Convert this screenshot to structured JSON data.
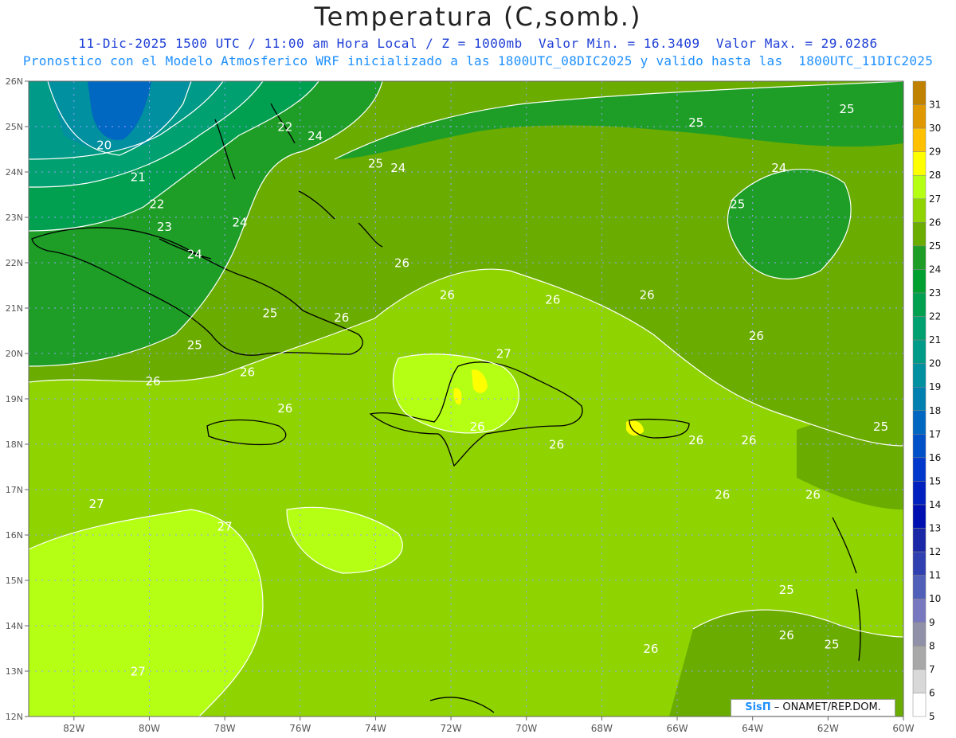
{
  "header": {
    "title": "Temperatura (C,somb.)",
    "subtitle_line1": "11-Dic-2025 1500 UTC / 11:00 am Hora Local / Z = 1000mb  Valor Min. = 16.3409  Valor Max. = 29.0286",
    "subtitle_line2": "Pronostico con el Modelo Atmosferico WRF inicializado a las 1800UTC_08DIC2025 y valido hasta las  1800UTC_11DIC2025"
  },
  "map": {
    "lon_range": [
      -83.2,
      -60
    ],
    "lat_range": [
      12,
      26
    ],
    "lon_ticks": [
      {
        "value": -82,
        "label": "82W"
      },
      {
        "value": -80,
        "label": "80W"
      },
      {
        "value": -78,
        "label": "78W"
      },
      {
        "value": -76,
        "label": "76W"
      },
      {
        "value": -74,
        "label": "74W"
      },
      {
        "value": -72,
        "label": "72W"
      },
      {
        "value": -70,
        "label": "70W"
      },
      {
        "value": -68,
        "label": "68W"
      },
      {
        "value": -66,
        "label": "66W"
      },
      {
        "value": -64,
        "label": "64W"
      },
      {
        "value": -62,
        "label": "62W"
      },
      {
        "value": -60,
        "label": "60W"
      }
    ],
    "lat_ticks": [
      {
        "value": 26,
        "label": "26N"
      },
      {
        "value": 25,
        "label": "25N"
      },
      {
        "value": 24,
        "label": "24N"
      },
      {
        "value": 23,
        "label": "23N"
      },
      {
        "value": 22,
        "label": "22N"
      },
      {
        "value": 21,
        "label": "21N"
      },
      {
        "value": 20,
        "label": "20N"
      },
      {
        "value": 19,
        "label": "19N"
      },
      {
        "value": 18,
        "label": "18N"
      },
      {
        "value": 17,
        "label": "17N"
      },
      {
        "value": 16,
        "label": "16N"
      },
      {
        "value": 15,
        "label": "15N"
      },
      {
        "value": 14,
        "label": "14N"
      },
      {
        "value": 13,
        "label": "13N"
      },
      {
        "value": 12,
        "label": "12N"
      }
    ],
    "contour_labels": [
      {
        "lon": -81.2,
        "lat": 24.5,
        "value": "20"
      },
      {
        "lon": -80.3,
        "lat": 23.8,
        "value": "21"
      },
      {
        "lon": -79.8,
        "lat": 23.2,
        "value": "22"
      },
      {
        "lon": -79.6,
        "lat": 22.7,
        "value": "23"
      },
      {
        "lon": -77.6,
        "lat": 22.8,
        "value": "24"
      },
      {
        "lon": -78.8,
        "lat": 22.1,
        "value": "24"
      },
      {
        "lon": -76.4,
        "lat": 24.9,
        "value": "22"
      },
      {
        "lon": -75.6,
        "lat": 24.7,
        "value": "24"
      },
      {
        "lon": -74.0,
        "lat": 24.1,
        "value": "25"
      },
      {
        "lon": -73.4,
        "lat": 24.0,
        "value": "24"
      },
      {
        "lon": -78.8,
        "lat": 20.1,
        "value": "25"
      },
      {
        "lon": -79.9,
        "lat": 19.3,
        "value": "26"
      },
      {
        "lon": -76.8,
        "lat": 20.8,
        "value": "25"
      },
      {
        "lon": -77.4,
        "lat": 19.5,
        "value": "26"
      },
      {
        "lon": -73.3,
        "lat": 21.9,
        "value": "26"
      },
      {
        "lon": -72.1,
        "lat": 21.2,
        "value": "26"
      },
      {
        "lon": -74.9,
        "lat": 20.7,
        "value": "26"
      },
      {
        "lon": -76.4,
        "lat": 18.7,
        "value": "26"
      },
      {
        "lon": -69.3,
        "lat": 21.1,
        "value": "26"
      },
      {
        "lon": -66.8,
        "lat": 21.2,
        "value": "26"
      },
      {
        "lon": -70.6,
        "lat": 19.9,
        "value": "27"
      },
      {
        "lon": -71.3,
        "lat": 18.3,
        "value": "26"
      },
      {
        "lon": -69.2,
        "lat": 17.9,
        "value": "26"
      },
      {
        "lon": -65.5,
        "lat": 18.0,
        "value": "26"
      },
      {
        "lon": -64.1,
        "lat": 18.0,
        "value": "26"
      },
      {
        "lon": -64.8,
        "lat": 16.8,
        "value": "26"
      },
      {
        "lon": -62.4,
        "lat": 16.8,
        "value": "26"
      },
      {
        "lon": -60.6,
        "lat": 18.3,
        "value": "25"
      },
      {
        "lon": -65.5,
        "lat": 25.0,
        "value": "25"
      },
      {
        "lon": -63.3,
        "lat": 24.0,
        "value": "24"
      },
      {
        "lon": -64.4,
        "lat": 23.2,
        "value": "25"
      },
      {
        "lon": -61.5,
        "lat": 25.3,
        "value": "25"
      },
      {
        "lon": -63.9,
        "lat": 20.3,
        "value": "26"
      },
      {
        "lon": -81.4,
        "lat": 16.6,
        "value": "27"
      },
      {
        "lon": -78.0,
        "lat": 16.1,
        "value": "27"
      },
      {
        "lon": -80.3,
        "lat": 12.9,
        "value": "27"
      },
      {
        "lon": -63.1,
        "lat": 14.7,
        "value": "25"
      },
      {
        "lon": -63.1,
        "lat": 13.7,
        "value": "26"
      },
      {
        "lon": -61.9,
        "lat": 13.5,
        "value": "25"
      },
      {
        "lon": -66.7,
        "lat": 13.4,
        "value": "26"
      }
    ]
  },
  "legend": {
    "levels": [
      {
        "label": "31",
        "color": "#c08000"
      },
      {
        "label": "30",
        "color": "#e09800"
      },
      {
        "label": "29",
        "color": "#ffc000"
      },
      {
        "label": "28",
        "color": "#ffff00"
      },
      {
        "label": "27",
        "color": "#b4ff14"
      },
      {
        "label": "26",
        "color": "#8fd400"
      },
      {
        "label": "25",
        "color": "#6aac00"
      },
      {
        "label": "24",
        "color": "#1e9e26"
      },
      {
        "label": "23",
        "color": "#00a030"
      },
      {
        "label": "22",
        "color": "#00a050"
      },
      {
        "label": "21",
        "color": "#00a070"
      },
      {
        "label": "20",
        "color": "#009a88"
      },
      {
        "label": "19",
        "color": "#0090a0"
      },
      {
        "label": "18",
        "color": "#0080b0"
      },
      {
        "label": "17",
        "color": "#0068c0"
      },
      {
        "label": "16",
        "color": "#0050c8"
      },
      {
        "label": "15",
        "color": "#0038cc"
      },
      {
        "label": "14",
        "color": "#0020c0"
      },
      {
        "label": "13",
        "color": "#0010b0"
      },
      {
        "label": "12",
        "color": "#1a28a8"
      },
      {
        "label": "11",
        "color": "#3040b0"
      },
      {
        "label": "10",
        "color": "#5060b8"
      },
      {
        "label": "9",
        "color": "#7878c0"
      },
      {
        "label": "8",
        "color": "#9090a8"
      },
      {
        "label": "7",
        "color": "#a8a8a8"
      },
      {
        "label": "6",
        "color": "#d8d8d8"
      },
      {
        "label": "5",
        "color": "#ffffff"
      }
    ]
  },
  "credit": {
    "brand": "SisΠ",
    "text": " – ONAMET/REP.DOM."
  },
  "colors": {
    "background_green": "#6aac00",
    "land_outline": "#000000",
    "contour_line": "#ffffff",
    "grid": "#9aa0ff"
  }
}
